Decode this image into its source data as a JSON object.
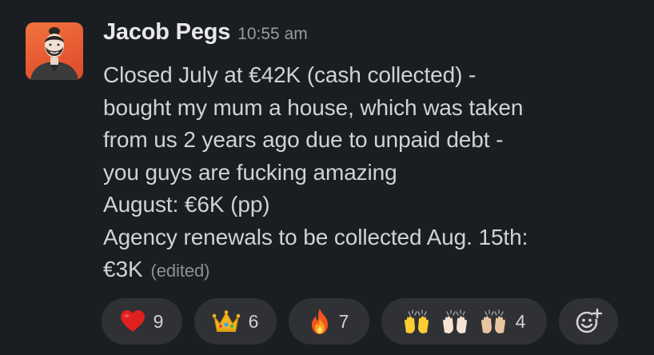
{
  "message": {
    "author": "Jacob Pegs",
    "timestamp": "10:55 am",
    "lines": [
      "Closed July at €42K (cash collected) -",
      "bought my mum a house, which was taken",
      "from us 2 years ago due to unpaid debt -",
      "you guys are fucking amazing",
      "August: €6K (pp)",
      "Agency renewals to be collected Aug. 15th:",
      "€3K"
    ],
    "edited_label": "(edited)"
  },
  "reactions": [
    {
      "emoji": "red-heart",
      "count": "9"
    },
    {
      "emoji": "crown",
      "count": "6"
    },
    {
      "emoji": "fire",
      "count": "7"
    },
    {
      "emoji": "raising-hands-skin-tones",
      "count": "4"
    }
  ],
  "add_reaction_icon": "add-emoji-icon",
  "colors": {
    "background": "#1a1d21",
    "pill": "#2f3135",
    "text": "#d1d2d3",
    "muted": "#9a9b9d",
    "avatar_bg": "#e85a33"
  }
}
